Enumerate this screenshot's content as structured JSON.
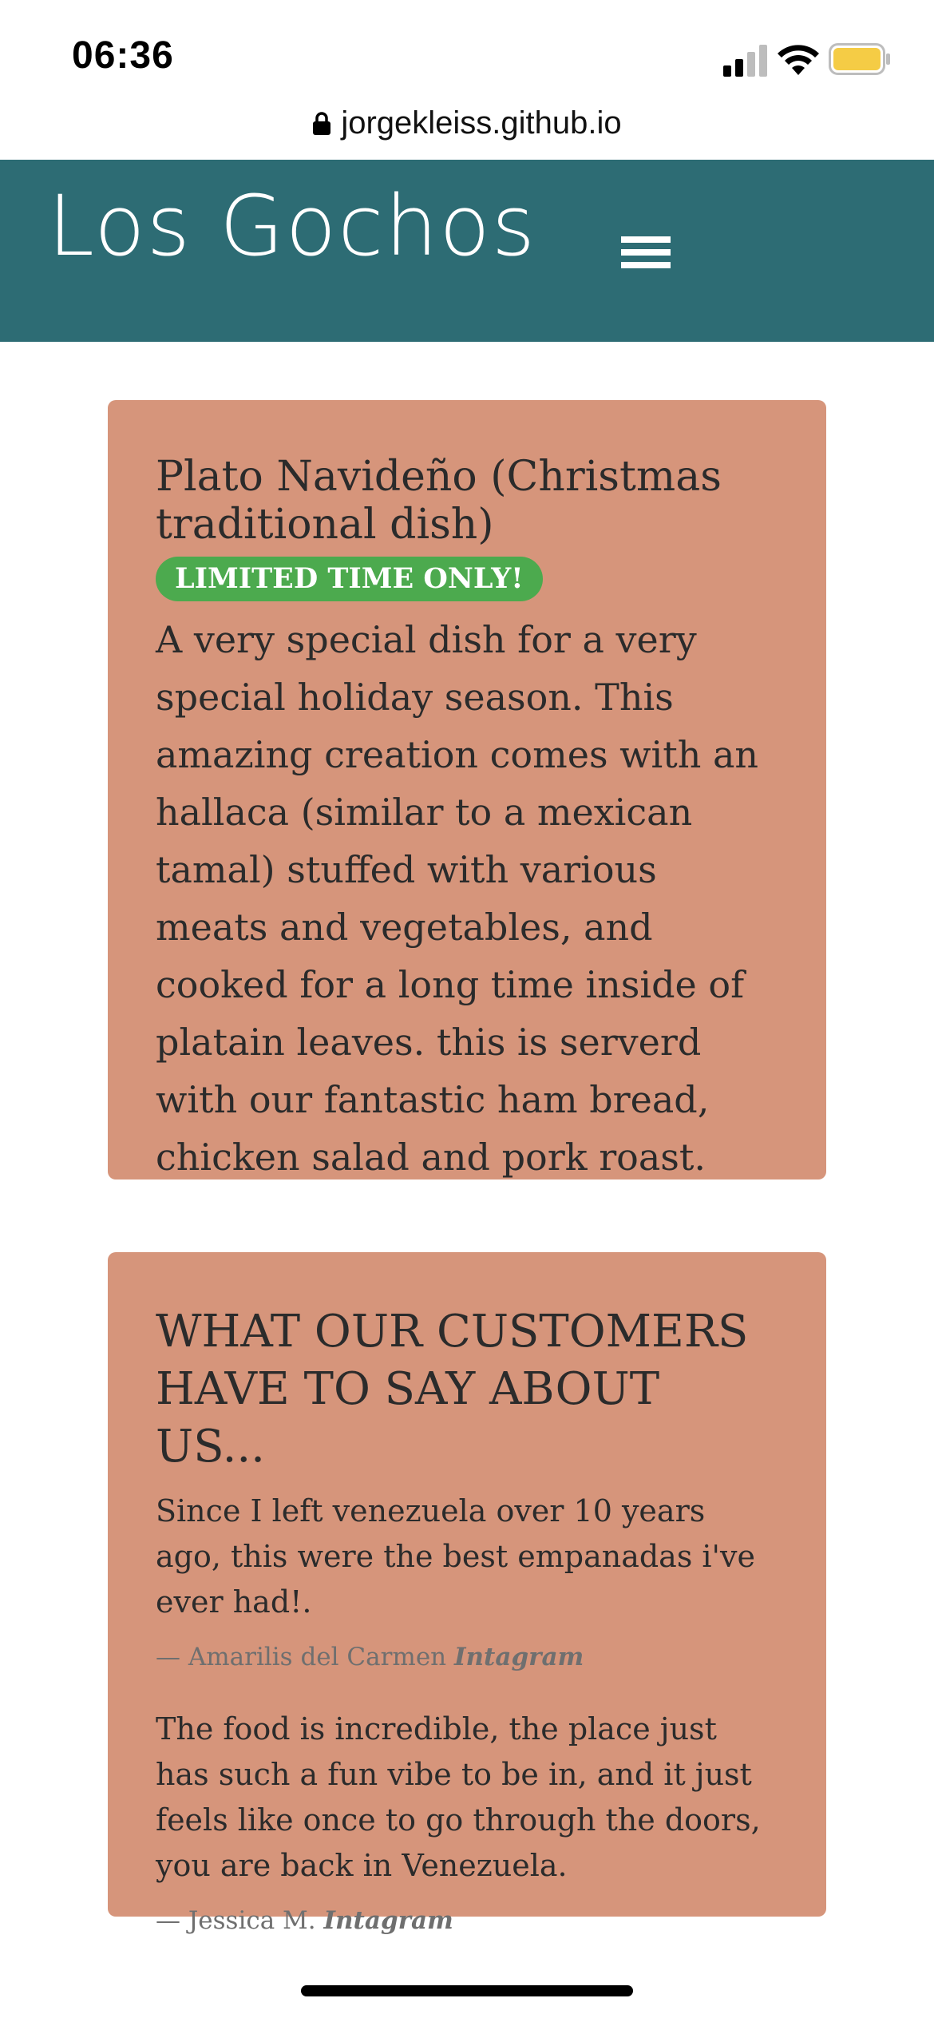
{
  "status_bar": {
    "time": "06:36",
    "battery_color": "#f5cc45"
  },
  "browser": {
    "url": "jorgekleiss.github.io"
  },
  "header": {
    "logo": "Los Gochos",
    "background": "#2d6c74"
  },
  "special": {
    "title": "Plato Navideño (Christmas traditional dish)",
    "badge": "LIMITED TIME ONLY!",
    "badge_color": "#4caa4e",
    "description": "A very special dish for a very special holiday season. This amazing creation comes with an hallaca (similar to a mexican tamal) stuffed with various meats and vegetables, and cooked for a long time inside of platain leaves. this is serverd with our fantastic ham bread, chicken salad and pork roast."
  },
  "reviews": {
    "title": "WHAT OUR CUSTOMERS HAVE TO SAY ABOUT US...",
    "items": [
      {
        "quote": "Since I left venezuela over 10 years ago, this were the best empanadas i've ever had!.",
        "author": "— Amarilis del Carmen",
        "source": "Intagram"
      },
      {
        "quote": "The food is incredible, the place just has such a fun vibe to be in, and it just feels like once to go through the doors, you are back in Venezuela.",
        "author": "— Jessica M.",
        "source": "Intagram"
      }
    ]
  },
  "card_color": "#d6957b"
}
